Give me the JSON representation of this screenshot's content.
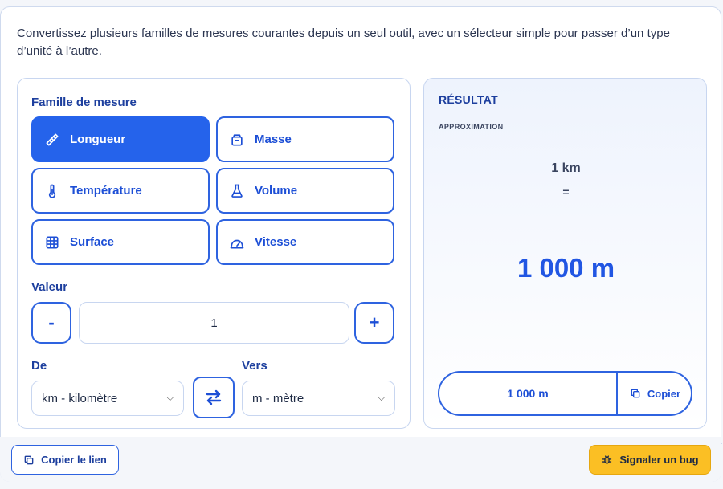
{
  "intro": "Convertissez plusieurs familles de mesures courantes depuis un seul outil, avec un sélecteur simple pour passer d’un type d’unité à l’autre.",
  "family": {
    "label": "Famille de mesure",
    "items": [
      {
        "label": "Longueur",
        "icon": "ruler-icon",
        "active": true
      },
      {
        "label": "Masse",
        "icon": "weight-icon",
        "active": false
      },
      {
        "label": "Température",
        "icon": "thermometer-icon",
        "active": false
      },
      {
        "label": "Volume",
        "icon": "flask-icon",
        "active": false
      },
      {
        "label": "Surface",
        "icon": "grid-icon",
        "active": false
      },
      {
        "label": "Vitesse",
        "icon": "gauge-icon",
        "active": false
      }
    ]
  },
  "value": {
    "label": "Valeur",
    "current": "1",
    "decrement": "-",
    "increment": "+"
  },
  "from": {
    "label": "De",
    "selected": "km - kilomètre"
  },
  "to": {
    "label": "Vers",
    "selected": "m - mètre"
  },
  "result": {
    "title": "RÉSULTAT",
    "subtitle": "APPROXIMATION",
    "input_display": "1 km",
    "equals": "=",
    "output_display": "1 000 m",
    "copy_value": "1 000 m",
    "copy_label": "Copier"
  },
  "footer": {
    "copy_link_label": "Copier le lien",
    "bug_label": "Signaler un bug"
  },
  "colors": {
    "accent": "#2563eb",
    "warning": "#fbbf24"
  }
}
